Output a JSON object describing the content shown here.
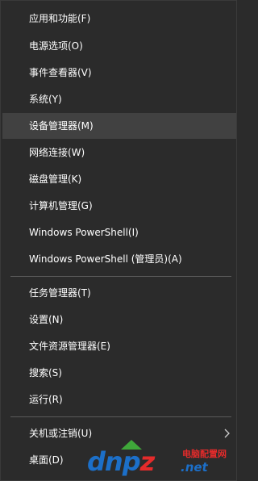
{
  "menu": {
    "group1": [
      {
        "label": "应用和功能(F)"
      },
      {
        "label": "电源选项(O)"
      },
      {
        "label": "事件查看器(V)"
      },
      {
        "label": "系统(Y)"
      },
      {
        "label": "设备管理器(M)"
      },
      {
        "label": "网络连接(W)"
      },
      {
        "label": "磁盘管理(K)"
      },
      {
        "label": "计算机管理(G)"
      },
      {
        "label": "Windows PowerShell(I)"
      },
      {
        "label": "Windows PowerShell (管理员)(A)"
      }
    ],
    "group2": [
      {
        "label": "任务管理器(T)"
      },
      {
        "label": "设置(N)"
      },
      {
        "label": "文件资源管理器(E)"
      },
      {
        "label": "搜索(S)"
      },
      {
        "label": "运行(R)"
      }
    ],
    "group3": [
      {
        "label": "关机或注销(U)",
        "submenu_icon": "chevron-right-icon"
      },
      {
        "label": "桌面(D)"
      }
    ],
    "highlighted_item": "设备管理器(M)"
  },
  "watermark": {
    "main": "dnpz",
    "main_prefix": "dnp",
    "main_suffix": "z",
    "cn_text": "电脑配置网",
    "domain": ".net",
    "colors": {
      "blue": "#1c6fc8",
      "red": "#e52b2b"
    }
  },
  "colors": {
    "background": "#2b2b2b",
    "hover": "#414141",
    "text": "#ffffff",
    "separator": "#5a5a5a"
  }
}
